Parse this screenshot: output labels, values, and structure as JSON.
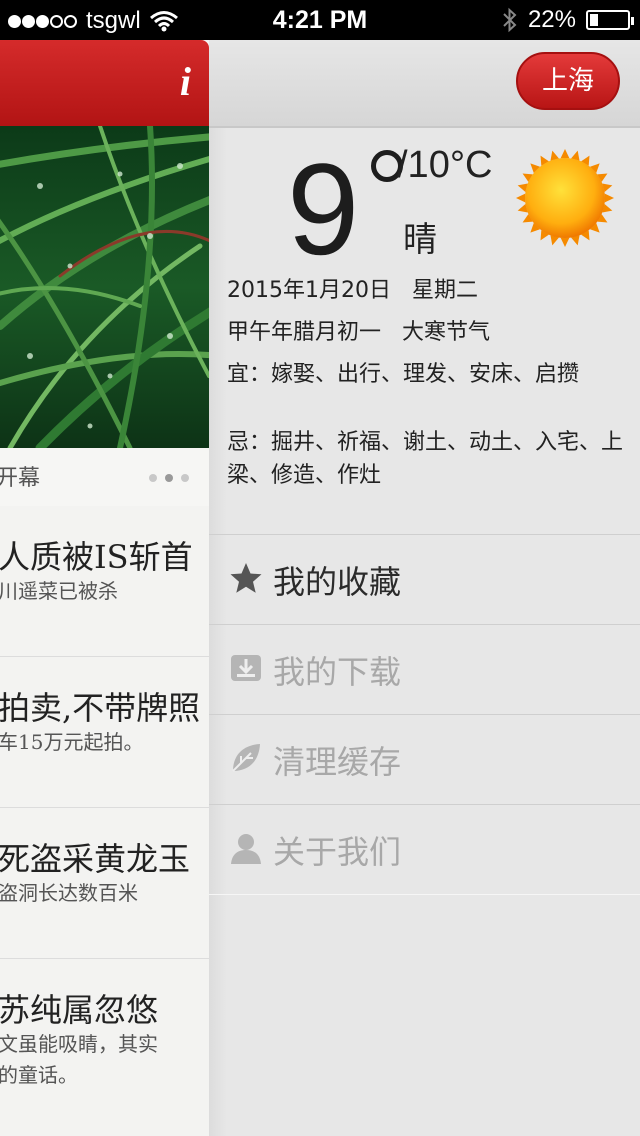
{
  "status_bar": {
    "carrier": "tsgwl",
    "time": "4:21 PM",
    "battery": "22%",
    "battery_level": 0.22,
    "signal_bars_filled": 3,
    "signal_bars_total": 5
  },
  "news": {
    "info_icon_label": "i",
    "banner_caption": "开幕",
    "pager_total": 3,
    "pager_active_index": 1,
    "items": [
      {
        "title": "人质被IS斩首",
        "lines": [
          "川遥菜已被杀"
        ]
      },
      {
        "title": "拍卖,不带牌照",
        "lines": [
          "车15万元起拍。"
        ]
      },
      {
        "title": "死盗采黄龙玉",
        "lines": [
          "盗洞长达数百米"
        ]
      },
      {
        "title": "苏纯属忽悠",
        "lines": [
          "文虽能吸睛，其实",
          "的童话。"
        ]
      }
    ]
  },
  "weather": {
    "city": "上海",
    "temp_current": "9",
    "temp_range": "/10°C",
    "condition": "晴",
    "icon": "sun-icon",
    "date": "2015年1月20日",
    "weekday": "星期二",
    "lunar": "甲午年腊月初一",
    "solar_term": "大寒节气",
    "suitable": "宜：嫁娶、出行、理发、安床、启攒",
    "avoid": "忌：掘井、祈福、谢土、动土、入宅、上梁、修造、作灶"
  },
  "menu": {
    "items": [
      {
        "label": "我的收藏",
        "icon": "star-icon",
        "active": true
      },
      {
        "label": "我的下载",
        "icon": "download-icon",
        "active": false
      },
      {
        "label": "清理缓存",
        "icon": "leaf-icon",
        "active": false
      },
      {
        "label": "关于我们",
        "icon": "user-icon",
        "active": false
      }
    ]
  },
  "colors": {
    "accent_red": "#c41f1f",
    "menu_active_text": "#2b2b2b",
    "menu_inactive_text": "#a8a8a8"
  }
}
